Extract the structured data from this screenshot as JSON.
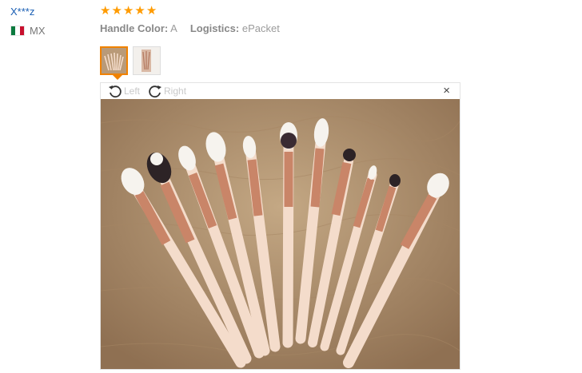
{
  "review": {
    "user": "X***z",
    "country": "MX",
    "rating": 5,
    "handle_color_label": "Handle Color:",
    "handle_color_value": "A",
    "logistics_label": "Logistics:",
    "logistics_value": "ePacket"
  },
  "viewer": {
    "rotate_left_label": "Left",
    "rotate_right_label": "Right",
    "close_glyph": "×"
  },
  "colors": {
    "star": "#ff9b00",
    "link": "#1a5fb4",
    "active_thumb": "#f08200",
    "brush_handle": "#f4dccb",
    "brush_ferrule": "#c98568"
  },
  "icons": [
    "rotate-left-icon",
    "rotate-right-icon",
    "close-icon",
    "star-icon",
    "mexico-flag-icon"
  ]
}
